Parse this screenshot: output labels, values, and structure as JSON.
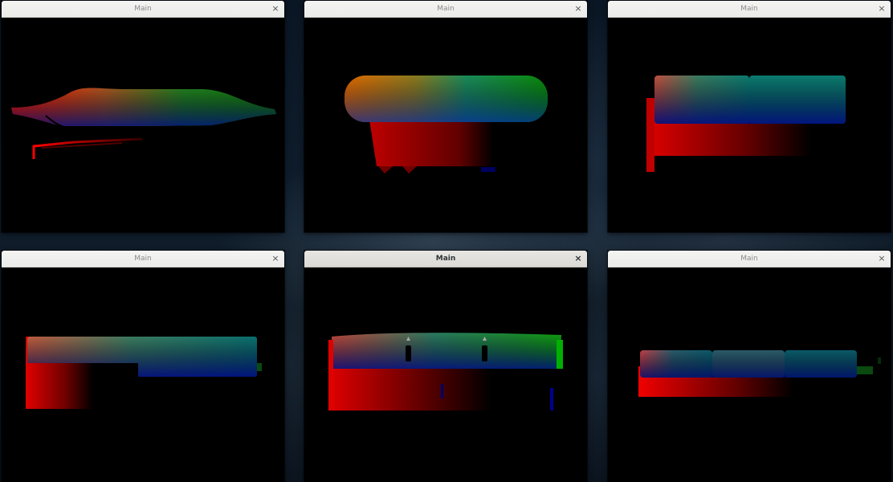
{
  "colors": {
    "titlebar": "#ecebea",
    "titlebar_active": "#dedcd8",
    "viewport": "#000000",
    "render_red": "#ff0000",
    "render_green": "#00aa00",
    "render_blue": "#0000aa"
  },
  "windows": [
    {
      "title": "Main",
      "close_icon": "×",
      "active": false,
      "model": "chaise-lounge"
    },
    {
      "title": "Main",
      "close_icon": "×",
      "active": false,
      "model": "tub-chair"
    },
    {
      "title": "Main",
      "close_icon": "×",
      "active": false,
      "model": "two-seat-sofa"
    },
    {
      "title": "Main",
      "close_icon": "×",
      "active": false,
      "model": "wide-sofa"
    },
    {
      "title": "Main",
      "close_icon": "×",
      "active": true,
      "model": "tufted-sofa"
    },
    {
      "title": "Main",
      "close_icon": "×",
      "active": false,
      "model": "three-seat-sofa"
    }
  ]
}
